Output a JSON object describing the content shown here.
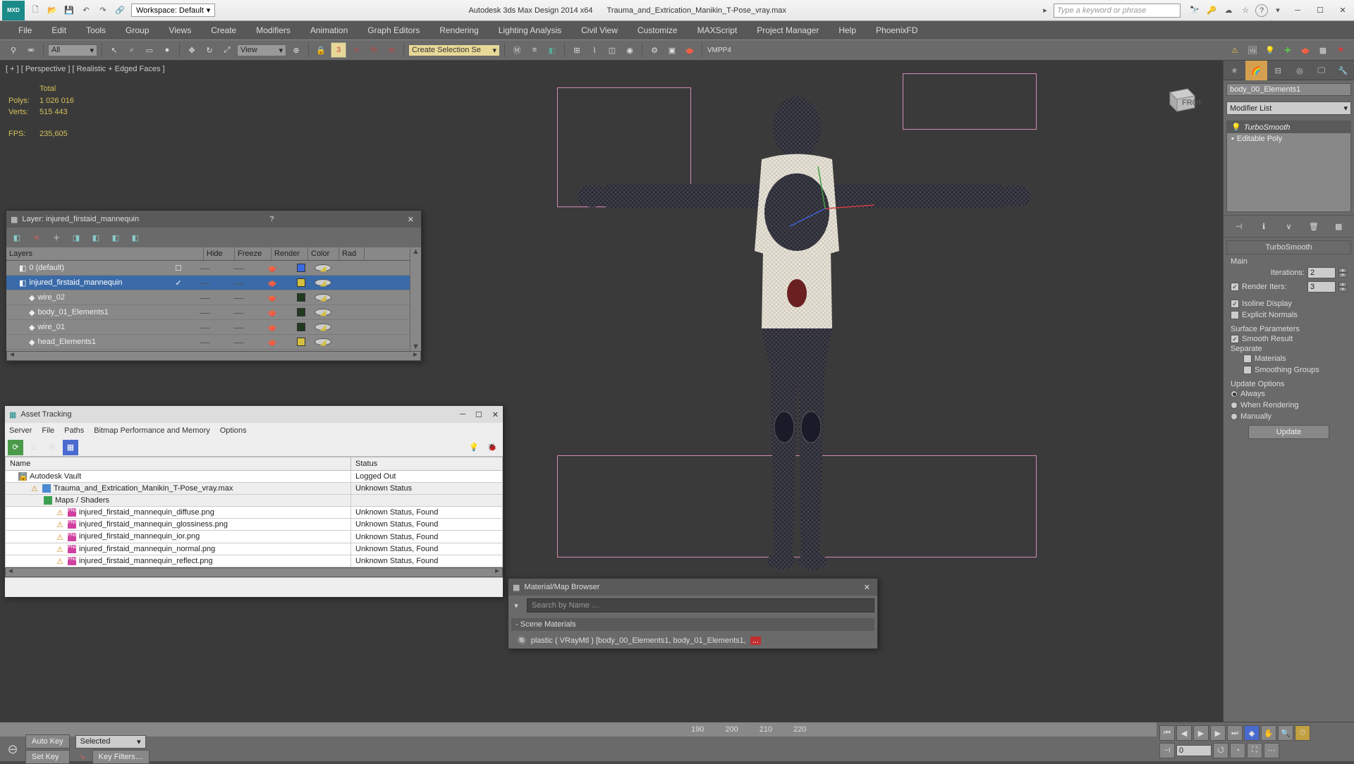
{
  "titlebar": {
    "workspace_label": "Workspace: Default",
    "app_title": "Autodesk 3ds Max Design 2014 x64",
    "file_name": "Trauma_and_Extrication_Manikin_T-Pose_vray.max",
    "search_placeholder": "Type a keyword or phrase"
  },
  "menubar": [
    "File",
    "Edit",
    "Tools",
    "Group",
    "Views",
    "Create",
    "Modifiers",
    "Animation",
    "Graph Editors",
    "Rendering",
    "Lighting Analysis",
    "Civil View",
    "Customize",
    "MAXScript",
    "Project Manager",
    "Help",
    "PhoenixFD"
  ],
  "toolbar": {
    "filter_dd": "All",
    "view_dd": "View",
    "sel_set": "Create Selection Se",
    "right_label": "VMPP4"
  },
  "viewport": {
    "label": "[ + ] [ Perspective ] [ Realistic + Edged Faces ]",
    "stats": {
      "total_label": "Total",
      "polys_label": "Polys:",
      "polys_val": "1 026 016",
      "verts_label": "Verts:",
      "verts_val": "515 443",
      "fps_label": "FPS:",
      "fps_val": "235,605"
    }
  },
  "cmd": {
    "obj_name": "body_00_Elements1",
    "mod_list_label": "Modifier List",
    "stack": [
      {
        "name": "TurboSmooth",
        "indent": true,
        "icon": "bulb"
      },
      {
        "name": "Editable Poly",
        "indent": false,
        "icon": "box"
      }
    ],
    "turbosmooth": {
      "title": "TurboSmooth",
      "main_label": "Main",
      "iterations_label": "Iterations:",
      "iterations_val": "2",
      "render_iters_label": "Render Iters:",
      "render_iters_val": "3",
      "render_iters_checked": true,
      "isoline_label": "Isoline Display",
      "isoline_checked": true,
      "explicit_label": "Explicit Normals",
      "explicit_checked": false,
      "surface_label": "Surface Parameters",
      "smooth_result_label": "Smooth Result",
      "smooth_result_checked": true,
      "separate_label": "Separate",
      "materials_label": "Materials",
      "materials_checked": false,
      "smoothing_groups_label": "Smoothing Groups",
      "smoothing_groups_checked": false,
      "update_label": "Update Options",
      "always_label": "Always",
      "when_rendering_label": "When Rendering",
      "manually_label": "Manually",
      "update_btn": "Update"
    }
  },
  "layer_panel": {
    "title": "Layer: injured_firstaid_mannequin",
    "columns": {
      "layers": "Layers",
      "hide": "Hide",
      "freeze": "Freeze",
      "render": "Render",
      "color": "Color",
      "rad": "Rad"
    },
    "rows": [
      {
        "name": "0 (default)",
        "indent": 1,
        "sel": false,
        "color": "#3a6ae0",
        "check": false
      },
      {
        "name": "injured_firstaid_mannequin",
        "indent": 1,
        "sel": true,
        "color": "#d4c040",
        "check": true
      },
      {
        "name": "wire_02",
        "indent": 2,
        "sel": false,
        "color": "#203a20"
      },
      {
        "name": "body_01_Elements1",
        "indent": 2,
        "sel": false,
        "color": "#203a20"
      },
      {
        "name": "wire_01",
        "indent": 2,
        "sel": false,
        "color": "#203a20"
      },
      {
        "name": "head_Elements1",
        "indent": 2,
        "sel": false,
        "color": "#d4c040"
      }
    ]
  },
  "asset_panel": {
    "title": "Asset Tracking",
    "menus": [
      "Server",
      "File",
      "Paths",
      "Bitmap Performance and Memory",
      "Options"
    ],
    "columns": {
      "name": "Name",
      "status": "Status"
    },
    "rows": [
      {
        "name": "Autodesk Vault",
        "status": "Logged Out",
        "indent": 1,
        "ico": "vault"
      },
      {
        "name": "Trauma_and_Extrication_Manikin_T-Pose_vray.max",
        "status": "Unknown Status",
        "indent": 2,
        "ico": "max",
        "g": true
      },
      {
        "name": "Maps / Shaders",
        "status": "",
        "indent": 3,
        "ico": "folder",
        "g": true
      },
      {
        "name": "injured_firstaid_mannequin_diffuse.png",
        "status": "Unknown Status, Found",
        "indent": 4,
        "ico": "png"
      },
      {
        "name": "injured_firstaid_mannequin_glossiness.png",
        "status": "Unknown Status, Found",
        "indent": 4,
        "ico": "png"
      },
      {
        "name": "injured_firstaid_mannequin_ior.png",
        "status": "Unknown Status, Found",
        "indent": 4,
        "ico": "png"
      },
      {
        "name": "injured_firstaid_mannequin_normal.png",
        "status": "Unknown Status, Found",
        "indent": 4,
        "ico": "png"
      },
      {
        "name": "injured_firstaid_mannequin_reflect.png",
        "status": "Unknown Status, Found",
        "indent": 4,
        "ico": "png"
      }
    ]
  },
  "mat_panel": {
    "title": "Material/Map Browser",
    "search_placeholder": "Search by Name …",
    "group": "Scene Materials",
    "item": "plastic ( VRayMtl ) [body_00_Elements1, body_01_Elements1,",
    "item_tail": "..."
  },
  "bottom": {
    "ticks": [
      "190",
      "200",
      "210",
      "220"
    ],
    "autokey": "Auto Key",
    "setkey": "Set Key",
    "selected": "Selected",
    "keyfilters": "Key Filters…",
    "frame": "0"
  }
}
